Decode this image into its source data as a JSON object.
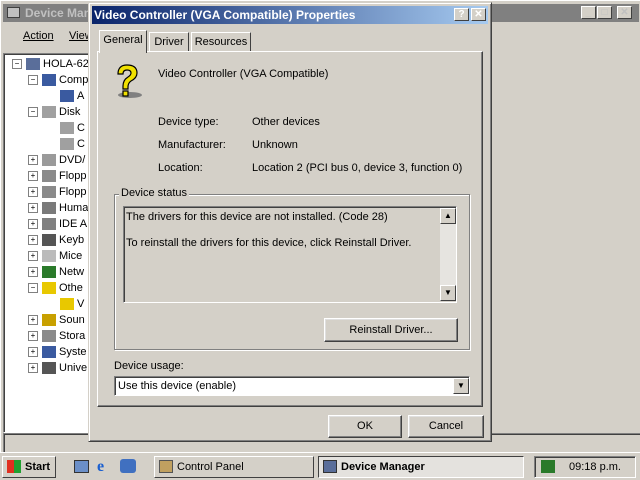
{
  "device_manager": {
    "title": "Device Manager",
    "menu": [
      "Action",
      "View"
    ],
    "tree": {
      "root": "HOLA-62",
      "items": [
        "Comp",
        "A",
        "Disk",
        "C",
        "C",
        "DVD/",
        "Flopp",
        "Flopp",
        "Huma",
        "IDE A",
        "Keyb",
        "Mice",
        "Netw",
        "Othe",
        "V",
        "Soun",
        "Stora",
        "Syste",
        "Unive"
      ]
    }
  },
  "dialog": {
    "title": "Video Controller (VGA Compatible) Properties",
    "help_label": "?",
    "close_label": "✕",
    "tabs": [
      "General",
      "Driver",
      "Resources"
    ],
    "device_name": "Video Controller (VGA Compatible)",
    "fields": {
      "type_label": "Device type:",
      "type_value": "Other devices",
      "manufacturer_label": "Manufacturer:",
      "manufacturer_value": "Unknown",
      "location_label": "Location:",
      "location_value": "Location 2 (PCI bus 0, device 3, function 0)"
    },
    "status_group_label": "Device status",
    "status_line1": "The drivers for this device are not installed. (Code 28)",
    "status_line2": "To reinstall the drivers for this device, click Reinstall Driver.",
    "reinstall_button": "Reinstall Driver...",
    "usage_label": "Device usage:",
    "usage_value": "Use this device (enable)",
    "ok_button": "OK",
    "cancel_button": "Cancel"
  },
  "taskbar": {
    "start_label": "Start",
    "tasks": [
      "Control Panel",
      "Device Manager"
    ],
    "clock": "09:18 p.m."
  },
  "colors": {
    "title_active": "#0a246a",
    "title_inactive": "#808080",
    "face": "#d4d0c8",
    "desktop": "#3a6ea5"
  }
}
